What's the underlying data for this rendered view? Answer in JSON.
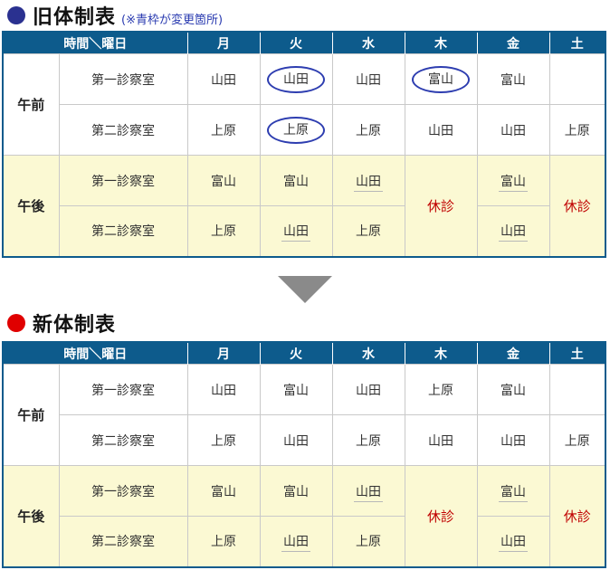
{
  "old": {
    "title": "旧体制表",
    "note": "(※青枠が変更箇所)",
    "dot_color": "#2a3190",
    "headers": [
      "時間＼曜日",
      "月",
      "火",
      "水",
      "木",
      "金",
      "土"
    ],
    "am_label": "午前",
    "pm_label": "午後",
    "room1": "第一診察室",
    "room2": "第二診察室",
    "am1": [
      "山田",
      "山田",
      "山田",
      "富山",
      "富山",
      ""
    ],
    "am2": [
      "上原",
      "上原",
      "上原",
      "山田",
      "山田",
      "上原"
    ],
    "pm1": [
      "富山",
      "富山",
      "山田",
      "休診",
      "富山",
      "休診"
    ],
    "pm2": [
      "上原",
      "山田",
      "上原",
      "山田"
    ]
  },
  "new": {
    "title": "新体制表",
    "dot_color": "#e00000",
    "headers": [
      "時間＼曜日",
      "月",
      "火",
      "水",
      "木",
      "金",
      "土"
    ],
    "am_label": "午前",
    "pm_label": "午後",
    "room1": "第一診察室",
    "room2": "第二診察室",
    "am1": [
      "山田",
      "富山",
      "山田",
      "上原",
      "富山",
      ""
    ],
    "am2": [
      "上原",
      "山田",
      "上原",
      "山田",
      "山田",
      "上原"
    ],
    "pm1": [
      "富山",
      "富山",
      "山田",
      "休診",
      "富山",
      "休診"
    ],
    "pm2": [
      "上原",
      "山田",
      "上原",
      "山田"
    ]
  }
}
